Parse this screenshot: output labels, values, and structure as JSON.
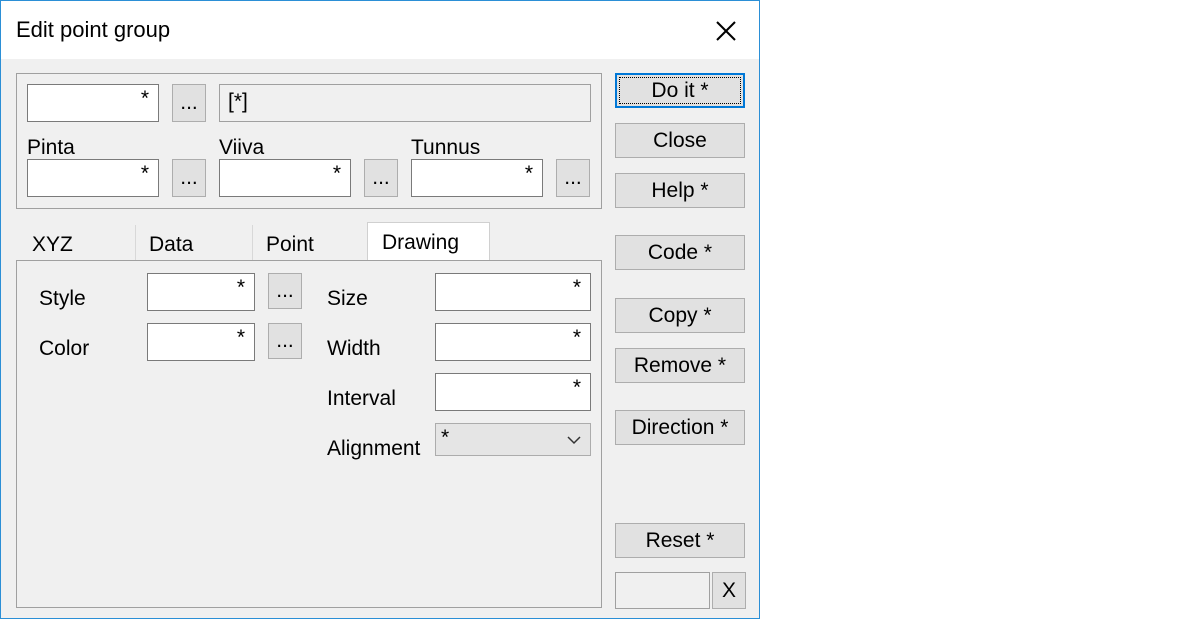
{
  "window": {
    "title": "Edit point group"
  },
  "header": {
    "field_top": "*",
    "browse": "...",
    "path_display": "[*]",
    "pinta_label": "Pinta",
    "pinta_value": "*",
    "viiva_label": "Viiva",
    "viiva_value": "*",
    "tunnus_label": "Tunnus",
    "tunnus_value": "*"
  },
  "tabs": [
    "XYZ",
    "Data",
    "Point",
    "Drawing"
  ],
  "active_tab": "Drawing",
  "drawing": {
    "style_label": "Style",
    "style_value": "*",
    "color_label": "Color",
    "color_value": "*",
    "size_label": "Size",
    "size_value": "*",
    "width_label": "Width",
    "width_value": "*",
    "interval_label": "Interval",
    "interval_value": "*",
    "alignment_label": "Alignment",
    "alignment_value": "*"
  },
  "buttons": {
    "do_it": "Do it *",
    "close": "Close",
    "help": "Help *",
    "code": "Code *",
    "copy": "Copy *",
    "remove": "Remove *",
    "direction": "Direction *",
    "reset": "Reset *",
    "x": "X"
  },
  "icons": {
    "close": "close-icon",
    "dropdown": "chevron-down-icon"
  }
}
